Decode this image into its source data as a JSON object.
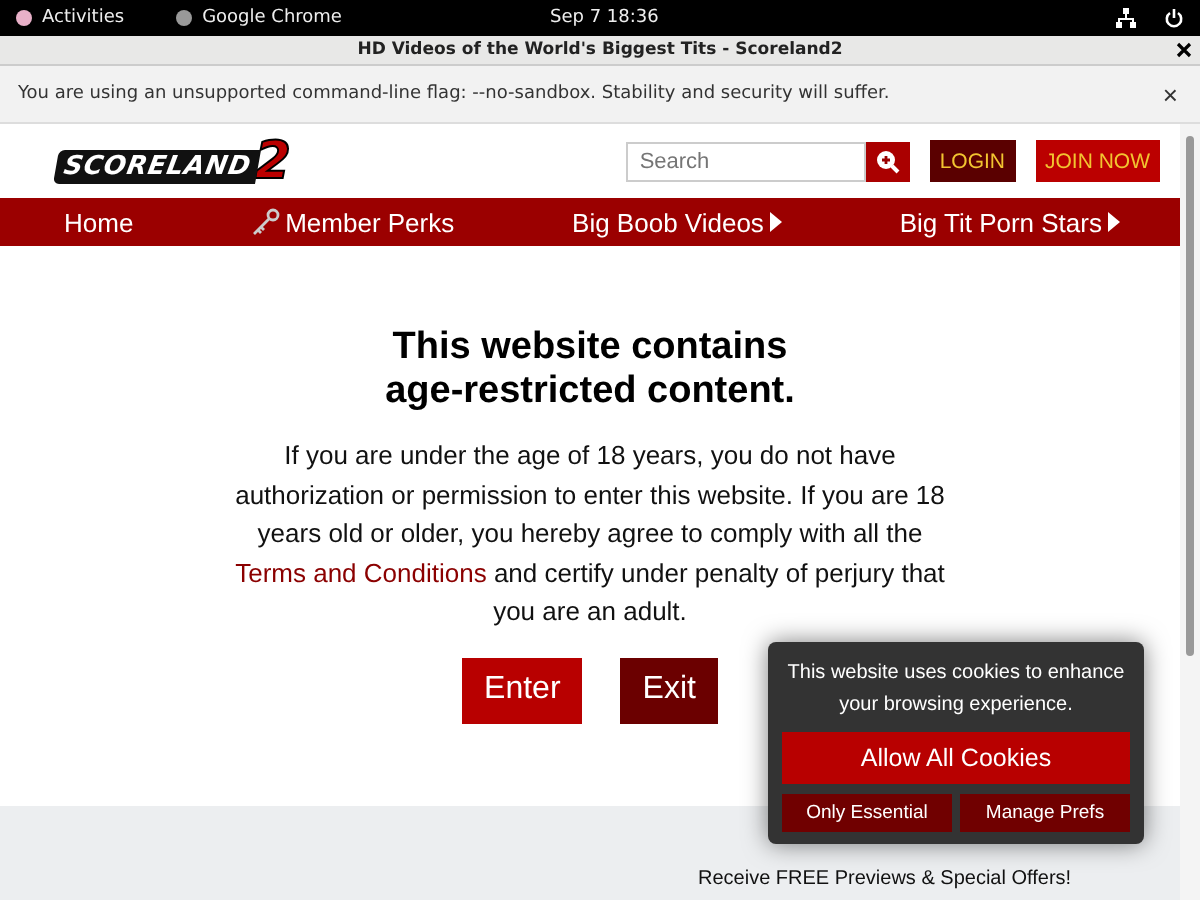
{
  "system_bar": {
    "activities": "Activities",
    "app": "Google Chrome",
    "clock": "Sep 7  18:36"
  },
  "window": {
    "title": "HD Videos of the World's Biggest Tits - Scoreland2"
  },
  "infobar": {
    "message": "You are using an unsupported command-line flag: --no-sandbox. Stability and security will suffer.",
    "close": "×"
  },
  "header": {
    "logo": "SCORELAND",
    "logo_mark": "2",
    "search": {
      "placeholder": "Search"
    },
    "login": "LOGIN",
    "join": "JOIN NOW"
  },
  "nav": [
    {
      "label": "Home",
      "kind": "link"
    },
    {
      "label": "Member Perks",
      "kind": "perks"
    },
    {
      "label": "Big Boob Videos",
      "kind": "dropdown"
    },
    {
      "label": "Big Tit Porn Stars",
      "kind": "dropdown"
    }
  ],
  "age_gate": {
    "heading_1": "This website contains",
    "heading_2": "age-restricted content.",
    "text_before": "If you are under the age of 18 years, you do not have authorization or permission to enter this website. If you are 18 years old or older, you hereby agree to comply with all the",
    "link": "Terms and Conditions",
    "text_after": "and certify under penalty of perjury that you are an adult.",
    "buttons": [
      "Enter",
      "Exit"
    ]
  },
  "footer": {
    "offer": "Receive FREE Previews & Special Offers!"
  },
  "cookie": {
    "message": "This website uses cookies to enhance your browsing experience.",
    "allow": "Allow All Cookies",
    "essential": "Only Essential",
    "prefs": "Manage Prefs"
  }
}
